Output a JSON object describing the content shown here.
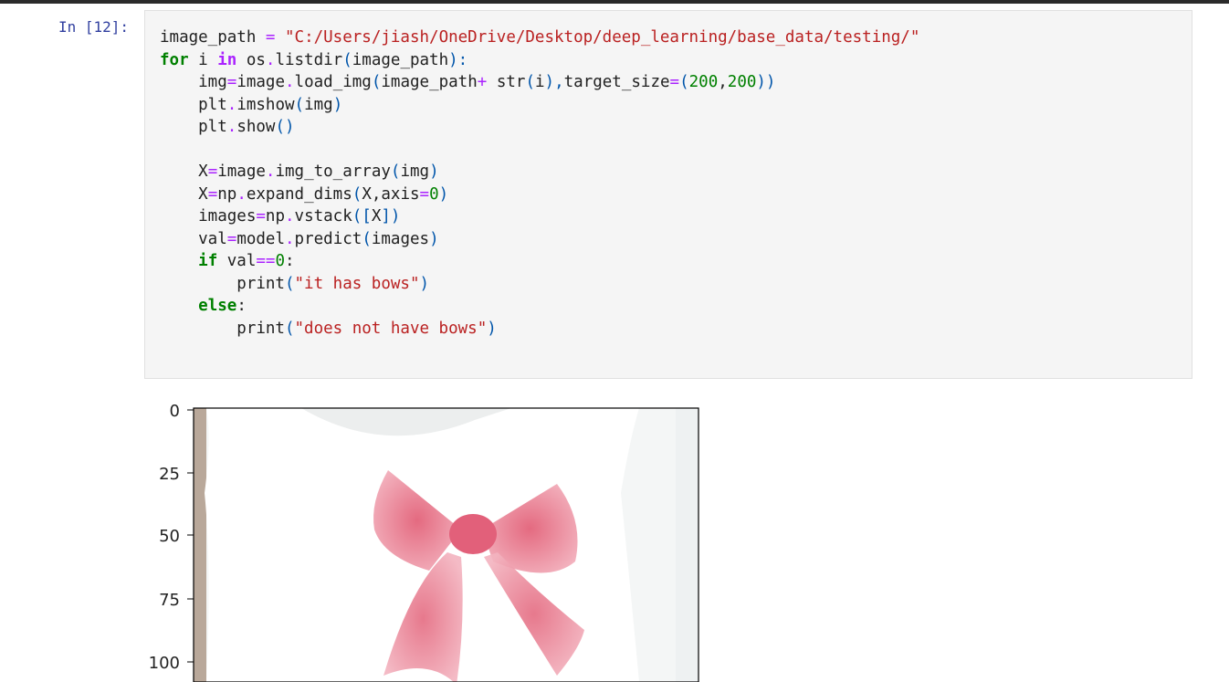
{
  "cell": {
    "prompt": "In [12]:",
    "lines": {
      "l1": {
        "a": "image_path ",
        "b": "=",
        "c": " ",
        "d": "\"C:/Users/jiash/OneDrive/Desktop/deep_learning/base_data/testing/\""
      },
      "l2": {
        "a": "for",
        "b": " i ",
        "c": "in",
        "d": " os",
        "e": ".",
        "f": "listdir",
        "g": "(",
        "h": "image_path",
        "i": "):"
      },
      "l3": {
        "a": "    img",
        "b": "=",
        "c": "image",
        "d": ".",
        "e": "load_img",
        "f": "(",
        "g": "image_path",
        "h": "+",
        "i": " str",
        "j": "(",
        "k": "i",
        "l": "),",
        "m": "target_size",
        "n": "=",
        "o": "(",
        "p": "200",
        "q": ",",
        "r": "200",
        "s": "))"
      },
      "l4": {
        "a": "    plt",
        "b": ".",
        "c": "imshow",
        "d": "(",
        "e": "img",
        "f": ")"
      },
      "l5": {
        "a": "    plt",
        "b": ".",
        "c": "show",
        "d": "()"
      },
      "l7": {
        "a": "    X",
        "b": "=",
        "c": "image",
        "d": ".",
        "e": "img_to_array",
        "f": "(",
        "g": "img",
        "h": ")"
      },
      "l8": {
        "a": "    X",
        "b": "=",
        "c": "np",
        "d": ".",
        "e": "expand_dims",
        "f": "(",
        "g": "X,axis",
        "h": "=",
        "i": "0",
        "j": ")"
      },
      "l9": {
        "a": "    images",
        "b": "=",
        "c": "np",
        "d": ".",
        "e": "vstack",
        "f": "([",
        "g": "X",
        "h": "])"
      },
      "l10": {
        "a": "    val",
        "b": "=",
        "c": "model",
        "d": ".",
        "e": "predict",
        "f": "(",
        "g": "images",
        "h": ")"
      },
      "l11": {
        "a": "    ",
        "b": "if",
        "c": " val",
        "d": "==",
        "e": "0",
        "f": ":"
      },
      "l12": {
        "a": "        print",
        "b": "(",
        "c": "\"it has bows\"",
        "d": ")"
      },
      "l13": {
        "a": "    ",
        "b": "else",
        "c": ":"
      },
      "l14": {
        "a": "        print",
        "b": "(",
        "c": "\"does not have bows\"",
        "d": ")"
      }
    }
  },
  "output": {
    "y_ticks": [
      "0",
      "25",
      "50",
      "75",
      "100"
    ],
    "image_description_icon": "shirt-with-pink-bow-image"
  },
  "colors": {
    "prompt": "#303f9f",
    "cell_bg": "#f5f5f5",
    "keyword": "#008000",
    "string": "#ba2121",
    "operator": "#aa22ff",
    "bow": "#e8788c"
  }
}
